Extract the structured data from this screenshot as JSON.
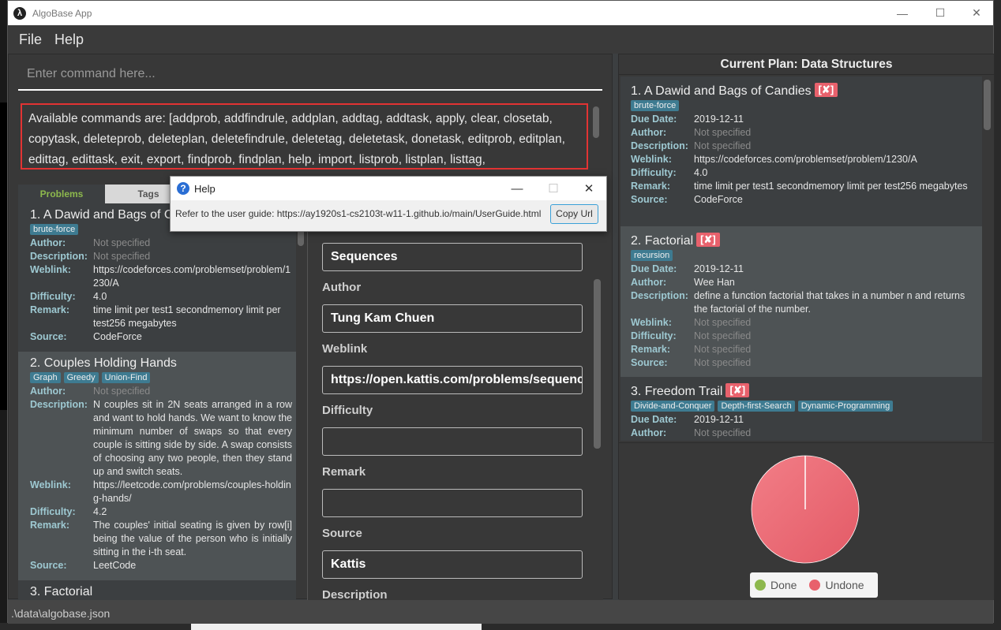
{
  "window": {
    "title": "AlgoBase App",
    "controls": {
      "minimize": "—",
      "maximize": "☐",
      "close": "✕"
    }
  },
  "menu": [
    "File",
    "Help"
  ],
  "command": {
    "placeholder": "Enter command here...",
    "value": ""
  },
  "result": {
    "text": "Available commands are: [addprob, addfindrule, addplan, addtag, addtask, apply, clear, closetab, copytask, deleteprob, deleteplan, deletefindrule, deletetag, deletetask, donetask, editprob, editplan, edittag, edittask, exit, export, findprob, findplan, help, import, listprob, listplan, listtag,"
  },
  "tabs": [
    {
      "label": "Problems",
      "active": true
    },
    {
      "label": "Tags",
      "active": false
    }
  ],
  "field_labels": {
    "author": "Author:",
    "description": "Description:",
    "weblink": "Weblink:",
    "difficulty": "Difficulty:",
    "remark": "Remark:",
    "source": "Source:",
    "due_date": "Due Date:"
  },
  "problems": [
    {
      "title": "1.  A Dawid and Bags of Candies",
      "tags": [
        "brute-force"
      ],
      "author": "Not specified",
      "description": "Not specified",
      "weblink": "https://codeforces.com/problemset/problem/1230/A",
      "difficulty": "4.0",
      "remark": "time limit per test1 secondmemory limit per test256 megabytes",
      "source": "CodeForce"
    },
    {
      "title": "2.  Couples Holding Hands",
      "tags": [
        "Graph",
        "Greedy",
        "Union-Find"
      ],
      "author": "Not specified",
      "description": "N couples sit in 2N seats arranged in a row and want to hold hands. We want to know the minimum number of swaps so that every couple is sitting side by side. A swap consists of choosing any two people, then they stand up and switch seats.",
      "weblink": "https://leetcode.com/problems/couples-holding-hands/",
      "difficulty": "4.2",
      "remark": "The couples' initial seating is given by row[i] being the value of the person who is initially sitting in the i-th seat.",
      "source": "LeetCode"
    },
    {
      "title": "3.  Factorial"
    }
  ],
  "edit_form": {
    "name_value": "Sequences",
    "author_label": "Author",
    "author_value": "Tung Kam Chuen",
    "weblink_label": "Weblink",
    "weblink_value": "https://open.kattis.com/problems/sequences",
    "difficulty_label": "Difficulty",
    "difficulty_value": "",
    "remark_label": "Remark",
    "remark_value": "",
    "source_label": "Source",
    "source_value": "Kattis",
    "description_label": "Description"
  },
  "plan": {
    "title": "Current Plan: Data Structures",
    "done_badge": "[✘]",
    "tasks": [
      {
        "title": "1.  A Dawid and Bags of Candies",
        "tags": [
          "brute-force"
        ],
        "due_date": "2019-12-11",
        "author": "Not specified",
        "description": "Not specified",
        "weblink": "https://codeforces.com/problemset/problem/1230/A",
        "difficulty": "4.0",
        "remark": "time limit per test1 secondmemory limit per test256 megabytes",
        "source": "CodeForce",
        "done": false
      },
      {
        "title": "2.  Factorial",
        "tags": [
          "recursion"
        ],
        "due_date": "2019-12-11",
        "author": "Wee Han",
        "description": "define a function factorial that takes in a number n and returns the factorial of the number.",
        "weblink": "Not specified",
        "difficulty": "Not specified",
        "remark": "Not specified",
        "source": "Not specified",
        "done": false
      },
      {
        "title": "3.  Freedom Trail",
        "tags": [
          "Divide-and-Conquer",
          "Depth-first-Search",
          "Dynamic-Programming"
        ],
        "due_date": "2019-12-11",
        "author": "Not specified",
        "done": false
      }
    ]
  },
  "progress_chart": {
    "legend": [
      {
        "label": "Done",
        "color": "#8db84d",
        "value": 0
      },
      {
        "label": "Undone",
        "color": "#e8616c",
        "value": 100
      }
    ]
  },
  "help_dialog": {
    "title": "Help",
    "message": "Refer to the user guide: https://ay1920s1-cs2103t-w11-1.github.io/main/UserGuide.html",
    "button": "Copy Url"
  },
  "status_bar": {
    "path": ".\\data\\algobase.json"
  },
  "colors": {
    "accent_red": "#e8616c",
    "tag_blue": "#3e7b91",
    "done_green": "#8db84d",
    "label_cyan": "#9ec9d2"
  }
}
